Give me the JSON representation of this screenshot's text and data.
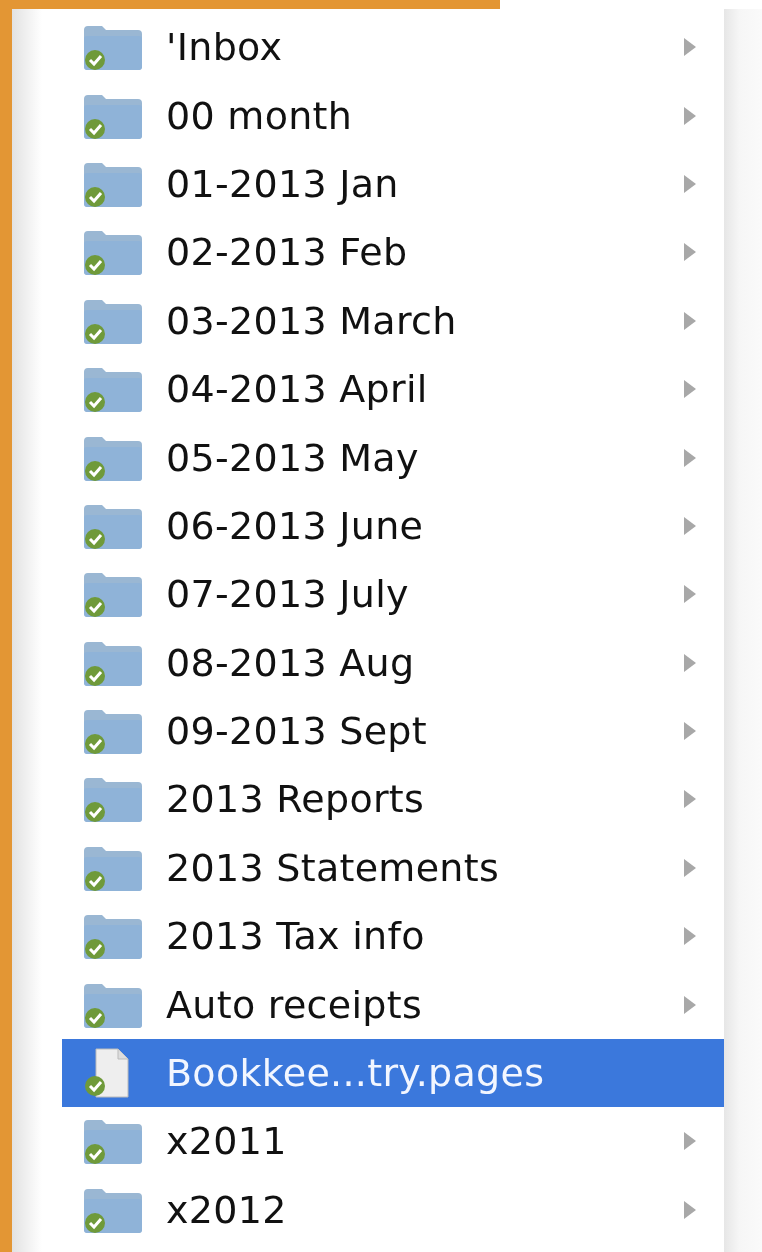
{
  "items": [
    {
      "name": "'Inbox",
      "kind": "folder",
      "selected": false
    },
    {
      "name": "00 month",
      "kind": "folder",
      "selected": false
    },
    {
      "name": "01-2013 Jan",
      "kind": "folder",
      "selected": false
    },
    {
      "name": "02-2013 Feb",
      "kind": "folder",
      "selected": false
    },
    {
      "name": "03-2013 March",
      "kind": "folder",
      "selected": false
    },
    {
      "name": "04-2013 April",
      "kind": "folder",
      "selected": false
    },
    {
      "name": "05-2013 May",
      "kind": "folder",
      "selected": false
    },
    {
      "name": "06-2013 June",
      "kind": "folder",
      "selected": false
    },
    {
      "name": "07-2013 July",
      "kind": "folder",
      "selected": false
    },
    {
      "name": "08-2013 Aug",
      "kind": "folder",
      "selected": false
    },
    {
      "name": "09-2013 Sept",
      "kind": "folder",
      "selected": false
    },
    {
      "name": "2013 Reports",
      "kind": "folder",
      "selected": false
    },
    {
      "name": "2013 Statements",
      "kind": "folder",
      "selected": false
    },
    {
      "name": "2013 Tax info",
      "kind": "folder",
      "selected": false
    },
    {
      "name": "Auto receipts",
      "kind": "folder",
      "selected": false
    },
    {
      "name": "Bookkee...try.pages",
      "kind": "document",
      "selected": true
    },
    {
      "name": "x2011",
      "kind": "folder",
      "selected": false
    },
    {
      "name": "x2012",
      "kind": "folder",
      "selected": false
    }
  ]
}
